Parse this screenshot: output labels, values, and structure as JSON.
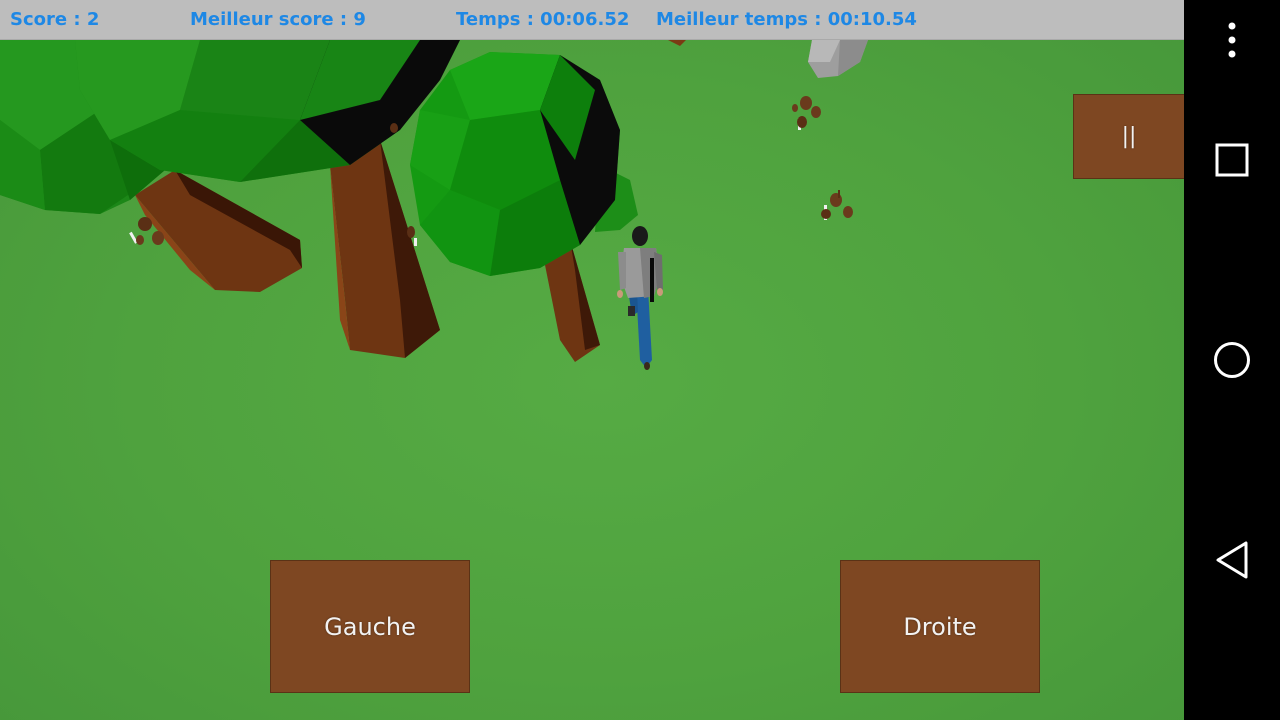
{
  "hud": {
    "score": "Score : 2",
    "best_score": "Meilleur score : 9",
    "time": "Temps : 00:06.52",
    "best_time": "Meilleur temps : 00:10.54",
    "text_color": "#1e88e5",
    "background": "#bdbdbd"
  },
  "controls": {
    "left_label": "Gauche",
    "right_label": "Droite",
    "pause_label": "||",
    "button_color": "#7e4722"
  },
  "nav_bar": {
    "icons": [
      "overflow-menu-icon",
      "recents-square-icon",
      "home-circle-icon",
      "back-triangle-icon"
    ]
  },
  "scene": {
    "ground_color": "#4fa23e",
    "foliage_colors": [
      "#1f8a1a",
      "#139010",
      "#0e7a0c"
    ],
    "trunk_color": "#6e3512",
    "rock_color": "#a9a9a9",
    "mushroom_color": "#6a3a1c",
    "player_shirt_color": "#9a9a9a",
    "player_pants_color": "#1f5fa0"
  }
}
